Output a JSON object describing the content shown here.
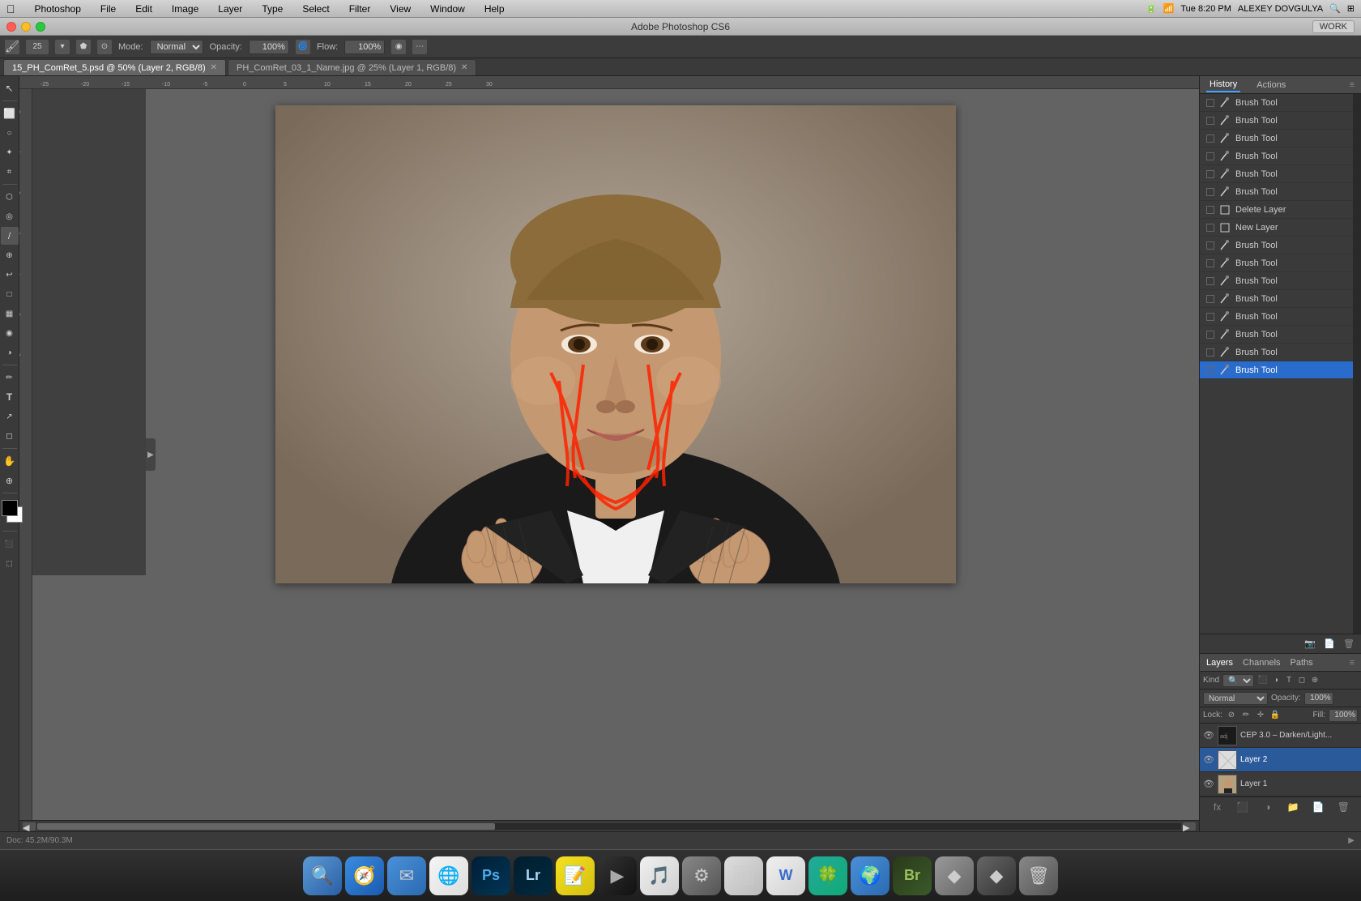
{
  "app": {
    "title": "Adobe Photoshop CS6",
    "menu": [
      "Photoshop",
      "File",
      "Edit",
      "Image",
      "Layer",
      "Type",
      "Select",
      "Filter",
      "View",
      "Window",
      "Help"
    ]
  },
  "menubar": {
    "right": {
      "time": "Tue 8:20 PM",
      "user": "ALEXEY  DOVGULYA"
    }
  },
  "titlebar": {
    "workspace_label": "WORK"
  },
  "optionsbar": {
    "mode_label": "Mode:",
    "mode_value": "Normal",
    "opacity_label": "Opacity:",
    "opacity_value": "100%",
    "flow_label": "Flow:",
    "flow_value": "100%"
  },
  "tabs": [
    {
      "name": "15_PH_ComRet_5.psd @ 50% (Layer 2, RGB/8)",
      "active": true
    },
    {
      "name": "PH_ComRet_03_1_Name.jpg @ 25% (Layer 1, RGB/8)",
      "active": false
    }
  ],
  "history": {
    "panel_tabs": [
      "History",
      "Actions"
    ],
    "items": [
      {
        "label": "Brush Tool",
        "selected": false,
        "icon": "brush"
      },
      {
        "label": "Brush Tool",
        "selected": false,
        "icon": "brush"
      },
      {
        "label": "Brush Tool",
        "selected": false,
        "icon": "brush"
      },
      {
        "label": "Brush Tool",
        "selected": false,
        "icon": "brush"
      },
      {
        "label": "Brush Tool",
        "selected": false,
        "icon": "brush"
      },
      {
        "label": "Brush Tool",
        "selected": false,
        "icon": "brush"
      },
      {
        "label": "Delete Layer",
        "selected": false,
        "icon": "layer"
      },
      {
        "label": "New Layer",
        "selected": false,
        "icon": "layer"
      },
      {
        "label": "Brush Tool",
        "selected": false,
        "icon": "brush"
      },
      {
        "label": "Brush Tool",
        "selected": false,
        "icon": "brush"
      },
      {
        "label": "Brush Tool",
        "selected": false,
        "icon": "brush"
      },
      {
        "label": "Brush Tool",
        "selected": false,
        "icon": "brush"
      },
      {
        "label": "Brush Tool",
        "selected": false,
        "icon": "brush"
      },
      {
        "label": "Brush Tool",
        "selected": false,
        "icon": "brush"
      },
      {
        "label": "Brush Tool",
        "selected": false,
        "icon": "brush"
      },
      {
        "label": "Brush Tool",
        "selected": true,
        "icon": "brush"
      }
    ]
  },
  "layers": {
    "panel_tabs": [
      "Layers",
      "Channels",
      "Paths"
    ],
    "active_tab": "Layers",
    "kind_label": "Kind",
    "blend_mode": "Normal",
    "opacity_label": "Opacity:",
    "opacity_value": "100%",
    "lock_label": "Lock:",
    "fill_label": "Fill:",
    "fill_value": "100%",
    "items": [
      {
        "name": "CEP 3.0 – Darken/Light...",
        "visible": true,
        "selected": false,
        "type": "adjustment"
      },
      {
        "name": "Layer 2",
        "visible": true,
        "selected": true,
        "type": "normal"
      },
      {
        "name": "Layer 1",
        "visible": true,
        "selected": false,
        "type": "photo"
      }
    ]
  },
  "statusbar": {
    "left_text": "Doc: 45.2M/90.3M"
  },
  "dock": {
    "icons": [
      {
        "name": "Finder",
        "symbol": "🔍",
        "color": "#5b9bd5"
      },
      {
        "name": "Safari",
        "symbol": "🧭",
        "color": "#4a90d9"
      },
      {
        "name": "Mail",
        "symbol": "✉️",
        "color": "#4a8fc9"
      },
      {
        "name": "Chrome",
        "symbol": "🌐",
        "color": "#4aba5a"
      },
      {
        "name": "Photoshop",
        "symbol": "Ps",
        "color": "#2fa4e7"
      },
      {
        "name": "Lightroom",
        "symbol": "Lr",
        "color": "#b4d9f5"
      },
      {
        "name": "Sticky",
        "symbol": "📝",
        "color": "#f5d442"
      },
      {
        "name": "Quicktime",
        "symbol": "▶",
        "color": "#888"
      },
      {
        "name": "iTunes",
        "symbol": "♫",
        "color": "#f06"
      },
      {
        "name": "Preferences",
        "symbol": "⚙",
        "color": "#888"
      },
      {
        "name": "Photos",
        "symbol": "🖼",
        "color": "#aaa"
      },
      {
        "name": "TextEdit",
        "symbol": "W",
        "color": "#3a6bc7"
      },
      {
        "name": "Something",
        "symbol": "🍀",
        "color": "#4a9"
      },
      {
        "name": "Browser",
        "symbol": "🌍",
        "color": "#4a90d9"
      },
      {
        "name": "Bridge",
        "symbol": "Br",
        "color": "#9b6"
      },
      {
        "name": "App16",
        "symbol": "◆",
        "color": "#aaa"
      },
      {
        "name": "App17",
        "symbol": "◆",
        "color": "#666"
      },
      {
        "name": "Trash",
        "symbol": "🗑",
        "color": "#888"
      }
    ]
  },
  "tools": [
    {
      "name": "move-tool",
      "symbol": "↖"
    },
    {
      "name": "marquee-tool",
      "symbol": "⬜"
    },
    {
      "name": "lasso-tool",
      "symbol": "○"
    },
    {
      "name": "quick-select-tool",
      "symbol": "✦"
    },
    {
      "name": "crop-tool",
      "symbol": "⌗"
    },
    {
      "name": "eyedropper-tool",
      "symbol": "🔍"
    },
    {
      "name": "spot-heal-tool",
      "symbol": "◎"
    },
    {
      "name": "brush-tool",
      "symbol": "/",
      "active": true
    },
    {
      "name": "clone-tool",
      "symbol": "⊕"
    },
    {
      "name": "eraser-tool",
      "symbol": "□"
    },
    {
      "name": "gradient-tool",
      "symbol": "▦"
    },
    {
      "name": "burn-tool",
      "symbol": "◑"
    },
    {
      "name": "pen-tool",
      "symbol": "✏"
    },
    {
      "name": "type-tool",
      "symbol": "T"
    },
    {
      "name": "path-select-tool",
      "symbol": "↗"
    },
    {
      "name": "shape-tool",
      "symbol": "◻"
    },
    {
      "name": "hand-tool",
      "symbol": "✋"
    },
    {
      "name": "zoom-tool",
      "symbol": "⊕"
    }
  ]
}
